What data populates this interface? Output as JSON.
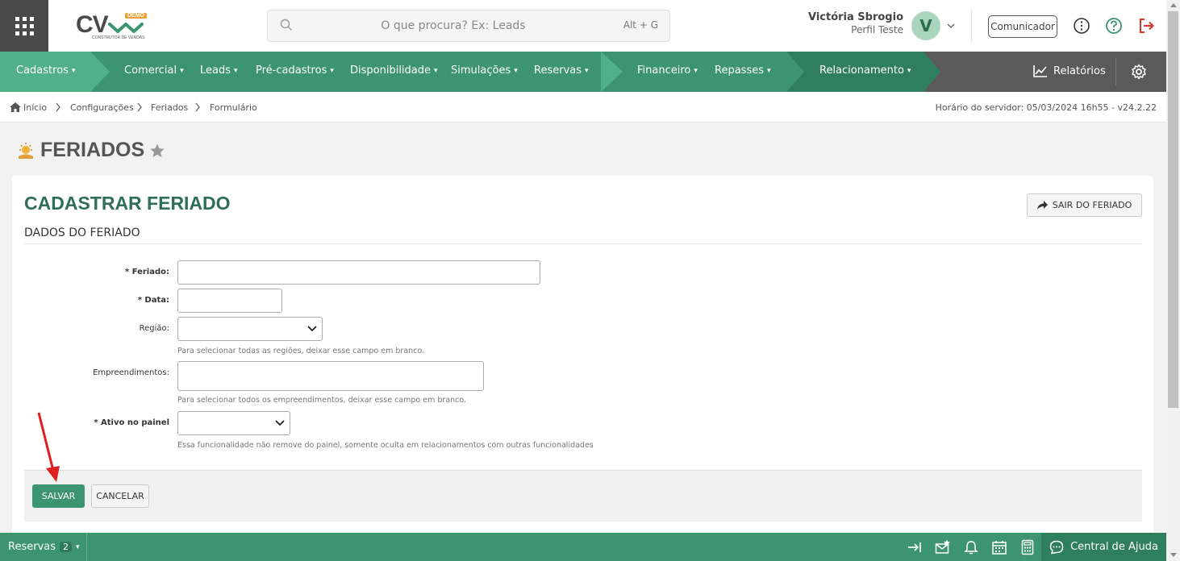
{
  "header": {
    "logo": {
      "text": "CV",
      "badge": "DEMO",
      "subtitle": "CONSTRUTOR DE VENDAS"
    },
    "search": {
      "placeholder": "O que procura? Ex: Leads",
      "shortcut": "Alt + G"
    },
    "user": {
      "name": "Victória Sbrogio",
      "profile": "Perfil Teste",
      "avatar_letter": "V"
    },
    "comunicador_label": "Comunicador",
    "icons": [
      "apps-grid-icon",
      "search-icon",
      "chevron-down-icon",
      "info-icon",
      "help-icon",
      "logout-icon"
    ]
  },
  "menu": {
    "items": [
      {
        "label": "Cadastros"
      },
      {
        "label": "Comercial"
      },
      {
        "label": "Leads"
      },
      {
        "label": "Pré-cadastros"
      },
      {
        "label": "Disponibilidade"
      },
      {
        "label": "Simulações"
      },
      {
        "label": "Reservas"
      },
      {
        "label": "Financeiro"
      },
      {
        "label": "Repasses"
      },
      {
        "label": "Relacionamento"
      }
    ],
    "reports_label": "Relatórios",
    "colors": {
      "bar": "#3c9470",
      "arrow": "#52b088",
      "dark": "#2f7f5e",
      "gray": "#5a5a5a"
    }
  },
  "breadcrumb": {
    "items": [
      "Início",
      "Configurações",
      "Feriados",
      "Formulário"
    ],
    "server_time": "Horário do servidor: 05/03/2024 16h55 - v24.2.22"
  },
  "page": {
    "title": "FERIADOS"
  },
  "form": {
    "title": "CADASTRAR FERIADO",
    "exit_label": "SAIR DO FERIADO",
    "section": "DADOS DO FERIADO",
    "fields": {
      "feriado": {
        "label": "* Feriado:",
        "value": ""
      },
      "data": {
        "label": "* Data:",
        "value": ""
      },
      "regiao": {
        "label": "Região:",
        "value": "",
        "hint": "Para selecionar todas as regiões, deixar esse campo em branco."
      },
      "empreendimentos": {
        "label": "Empreendimentos:",
        "value": "",
        "hint": "Para selecionar todos os empreendimentos, deixar esse campo em branco."
      },
      "ativo": {
        "label": "* Ativo no painel",
        "value": "",
        "hint": "Essa funcionalidade não remove do painel, somente oculta em relacionamentos com outras funcionalidades"
      }
    },
    "save_label": "SALVAR",
    "cancel_label": "CANCELAR"
  },
  "bottom": {
    "reservas_label": "Reservas",
    "reservas_count": "2",
    "help_label": "Central de Ajuda"
  }
}
